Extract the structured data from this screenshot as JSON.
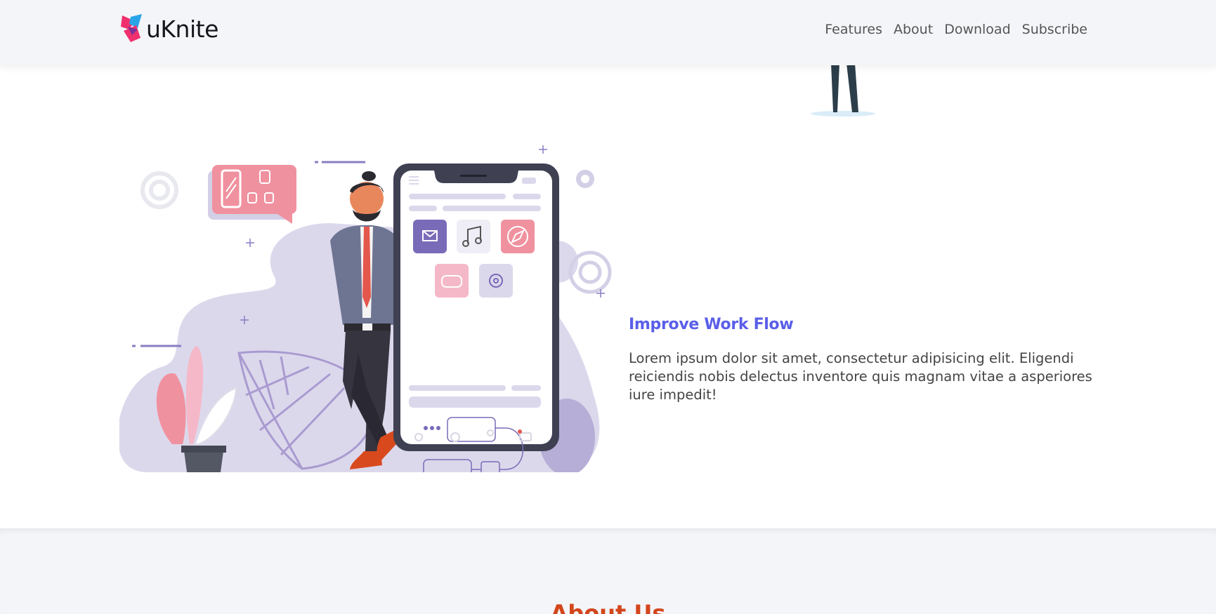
{
  "brand": {
    "name": "uKnite"
  },
  "nav": {
    "items": [
      {
        "label": "Features"
      },
      {
        "label": "About"
      },
      {
        "label": "Download"
      },
      {
        "label": "Subscribe"
      }
    ]
  },
  "feature": {
    "title": "Improve Work Flow",
    "body": "Lorem ipsum dolor sit amet, consectetur adipisicing elit. Eligendi reiciendis nobis delectus inventore quis magnam vitae a asperiores iure impedit!"
  },
  "about": {
    "title": "About Us"
  },
  "colors": {
    "accent": "#5a5ee8",
    "about_title": "#d3461c",
    "nav_bg": "#f4f5f8",
    "logo_pink": "#f0306e",
    "logo_blue": "#2aa4e8"
  },
  "icons": [
    "logo-icon",
    "mail-icon",
    "music-icon",
    "compass-icon",
    "gamepad-icon",
    "settings-icon",
    "search-icon",
    "profile-icon",
    "chat-icon",
    "gear-icon"
  ]
}
